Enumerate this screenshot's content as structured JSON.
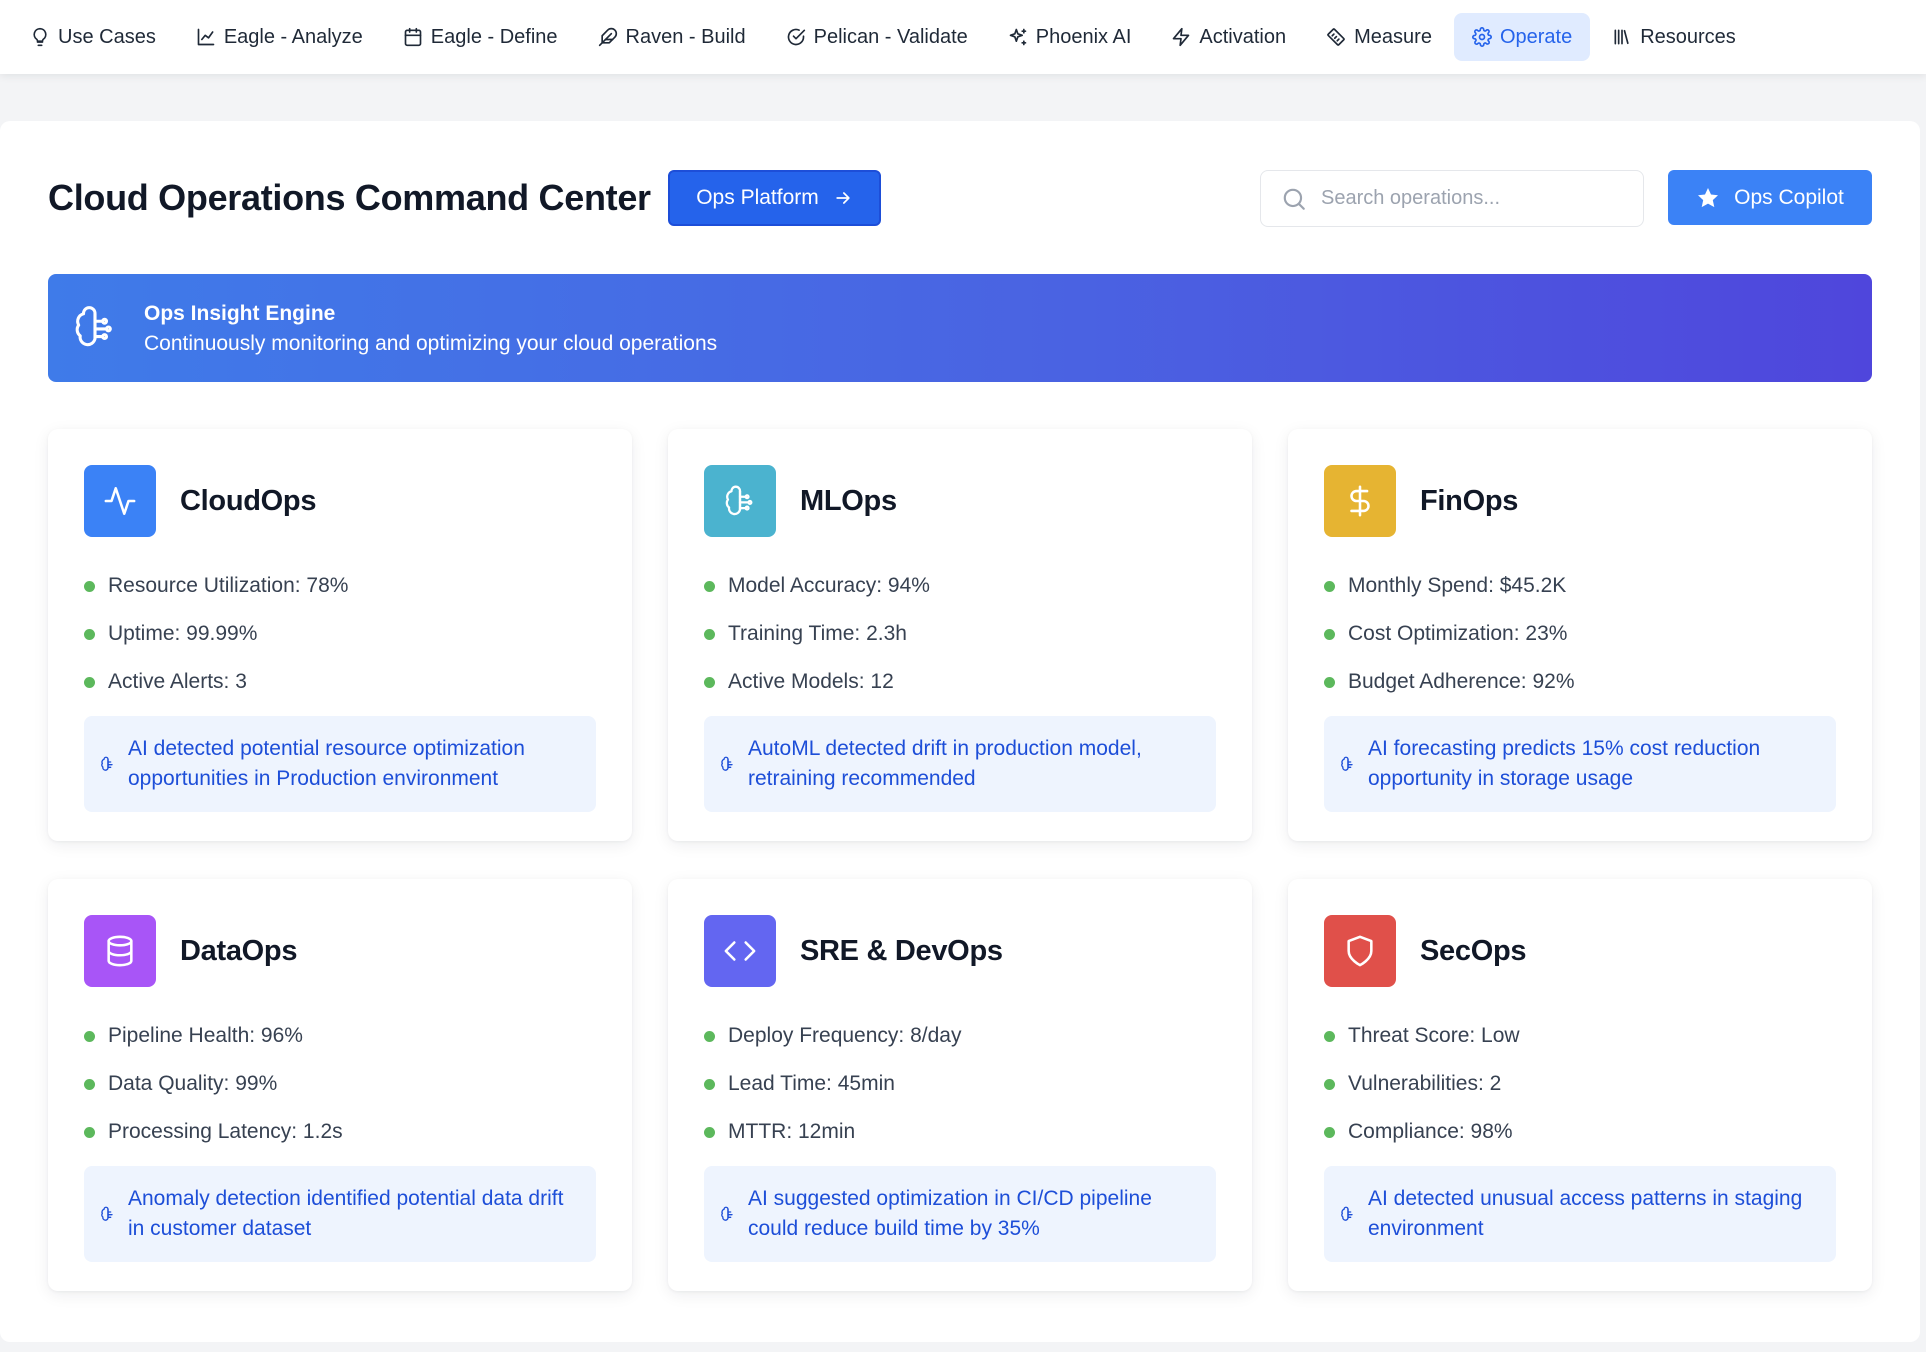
{
  "nav": {
    "items": [
      {
        "label": "Use Cases",
        "icon": "lightbulb-icon",
        "active": false
      },
      {
        "label": "Eagle - Analyze",
        "icon": "line-chart-icon",
        "active": false
      },
      {
        "label": "Eagle - Define",
        "icon": "calendar-icon",
        "active": false
      },
      {
        "label": "Raven - Build",
        "icon": "feather-icon",
        "active": false
      },
      {
        "label": "Pelican - Validate",
        "icon": "check-circle-icon",
        "active": false
      },
      {
        "label": "Phoenix AI",
        "icon": "sparkles-icon",
        "active": false
      },
      {
        "label": "Activation",
        "icon": "zap-icon",
        "active": false
      },
      {
        "label": "Measure",
        "icon": "ruler-icon",
        "active": false
      },
      {
        "label": "Operate",
        "icon": "gear-icon",
        "active": true
      },
      {
        "label": "Resources",
        "icon": "library-icon",
        "active": false
      }
    ]
  },
  "header": {
    "title": "Cloud Operations Command Center",
    "platform_button": "Ops Platform",
    "search_placeholder": "Search operations...",
    "copilot_button": "Ops Copilot"
  },
  "banner": {
    "title": "Ops Insight Engine",
    "subtitle": "Continuously monitoring and optimizing your cloud operations"
  },
  "colors": {
    "accent": "#2563eb",
    "status_dot": "#5cb85c",
    "insight_text": "#1d4ed8",
    "insight_bg": "#eef4fe"
  },
  "cards": [
    {
      "title": "CloudOps",
      "icon": "activity-icon",
      "color": "#3b82f6",
      "metrics": [
        "Resource Utilization: 78%",
        "Uptime: 99.99%",
        "Active Alerts: 3"
      ],
      "insight": "AI detected potential resource optimization opportunities in Production environment"
    },
    {
      "title": "MLOps",
      "icon": "brain-icon",
      "color": "#4bb3cf",
      "metrics": [
        "Model Accuracy: 94%",
        "Training Time: 2.3h",
        "Active Models: 12"
      ],
      "insight": "AutoML detected drift in production model, retraining recommended"
    },
    {
      "title": "FinOps",
      "icon": "dollar-icon",
      "color": "#e6b432",
      "metrics": [
        "Monthly Spend: $45.2K",
        "Cost Optimization: 23%",
        "Budget Adherence: 92%"
      ],
      "insight": "AI forecasting predicts 15% cost reduction opportunity in storage usage"
    },
    {
      "title": "DataOps",
      "icon": "database-icon",
      "color": "#a855f7",
      "metrics": [
        "Pipeline Health: 96%",
        "Data Quality: 99%",
        "Processing Latency: 1.2s"
      ],
      "insight": "Anomaly detection identified potential data drift in customer dataset"
    },
    {
      "title": "SRE & DevOps",
      "icon": "code-icon",
      "color": "#6366f1",
      "metrics": [
        "Deploy Frequency: 8/day",
        "Lead Time: 45min",
        "MTTR: 12min"
      ],
      "insight": "AI suggested optimization in CI/CD pipeline could reduce build time by 35%"
    },
    {
      "title": "SecOps",
      "icon": "shield-icon",
      "color": "#e0504a",
      "metrics": [
        "Threat Score: Low",
        "Vulnerabilities: 2",
        "Compliance: 98%"
      ],
      "insight": "AI detected unusual access patterns in staging environment"
    }
  ]
}
